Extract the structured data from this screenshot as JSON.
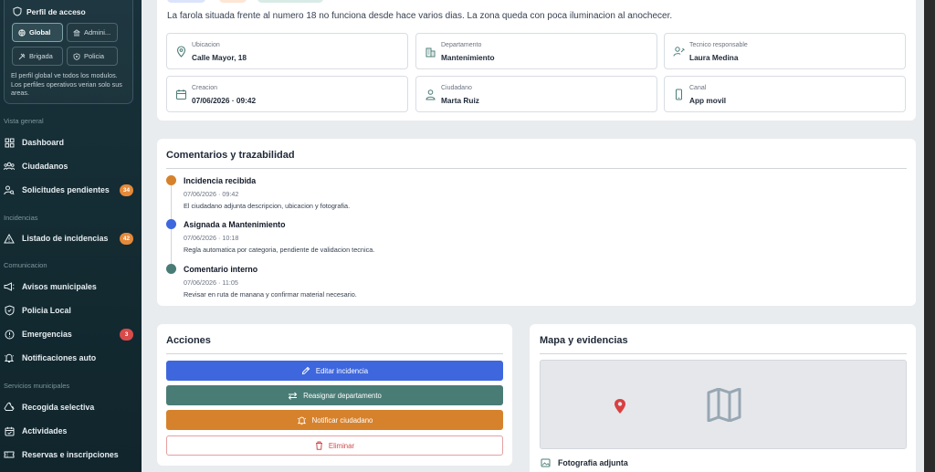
{
  "sidebar": {
    "profile": {
      "title": "Perfil de acceso",
      "options": [
        "Global",
        "Admini...",
        "Brigada",
        "Policia"
      ],
      "active": "Global",
      "note": "El perfil global ve todos los modulos. Los perfiles operativos verian solo sus areas."
    },
    "sections": [
      {
        "label": "Vista general",
        "items": [
          {
            "label": "Dashboard",
            "icon": "grid-icon"
          },
          {
            "label": "Ciudadanos",
            "icon": "users-icon"
          },
          {
            "label": "Solicitudes pendientes",
            "icon": "user-search-icon",
            "badge": "34",
            "badge_color": "#e58a3a"
          }
        ]
      },
      {
        "label": "Incidencias",
        "items": [
          {
            "label": "Listado de incidencias",
            "icon": "warning-icon",
            "badge": "42",
            "badge_color": "#e58a3a"
          }
        ]
      },
      {
        "label": "Comunicacion",
        "items": [
          {
            "label": "Avisos municipales",
            "icon": "megaphone-icon"
          },
          {
            "label": "Policia Local",
            "icon": "shield-icon"
          },
          {
            "label": "Emergencias",
            "icon": "alert-circle-icon",
            "badge": "3",
            "badge_color": "#d94b4b"
          },
          {
            "label": "Notificaciones auto",
            "icon": "bell-icon"
          }
        ]
      },
      {
        "label": "Servicios municipales",
        "items": [
          {
            "label": "Recogida selectiva",
            "icon": "recycle-icon"
          },
          {
            "label": "Actividades",
            "icon": "calendar-icon"
          },
          {
            "label": "Reservas e inscripciones",
            "icon": "ticket-icon"
          }
        ]
      }
    ]
  },
  "detail": {
    "description": "La farola situada frente al numero 18 no funciona desde hace varios dias. La zona queda con poca iluminacion al anochecer.",
    "fields": [
      {
        "label": "Ubicacion",
        "value": "Calle Mayor, 18",
        "icon": "map-pin-icon"
      },
      {
        "label": "Departamento",
        "value": "Mantenimiento",
        "icon": "building-icon"
      },
      {
        "label": "Tecnico responsable",
        "value": "Laura Medina",
        "icon": "user-tool-icon"
      },
      {
        "label": "Creacion",
        "value": "07/06/2026 · 09:42",
        "icon": "calendar-icon"
      },
      {
        "label": "Ciudadano",
        "value": "Marta Ruiz",
        "icon": "user-icon"
      },
      {
        "label": "Canal",
        "value": "App movil",
        "icon": "phone-icon"
      }
    ]
  },
  "comments": {
    "title": "Comentarios y trazabilidad",
    "events": [
      {
        "title": "Incidencia recibida",
        "time": "07/06/2026 · 09:42",
        "desc": "El ciudadano adjunta descripcion, ubicacion y fotografia.",
        "color": "#d6822c"
      },
      {
        "title": "Asignada a Mantenimiento",
        "time": "07/06/2026 · 10:18",
        "desc": "Regla automatica por categoria, pendiente de validacion tecnica.",
        "color": "#3e67de"
      },
      {
        "title": "Comentario interno",
        "time": "07/06/2026 · 11:05",
        "desc": "Revisar en ruta de manana y confirmar material necesario.",
        "color": "#4a7c76"
      }
    ]
  },
  "actions": {
    "title": "Acciones",
    "edit": "Editar incidencia",
    "reassign": "Reasignar departamento",
    "notify": "Notificar ciudadano",
    "delete": "Eliminar"
  },
  "map": {
    "title": "Mapa y evidencias",
    "photo_label": "Fotografia adjunta"
  },
  "colors": {
    "blue": "#3e67de",
    "teal": "#4a7c76",
    "orange": "#d6822c",
    "danger": "#d24a4a"
  }
}
